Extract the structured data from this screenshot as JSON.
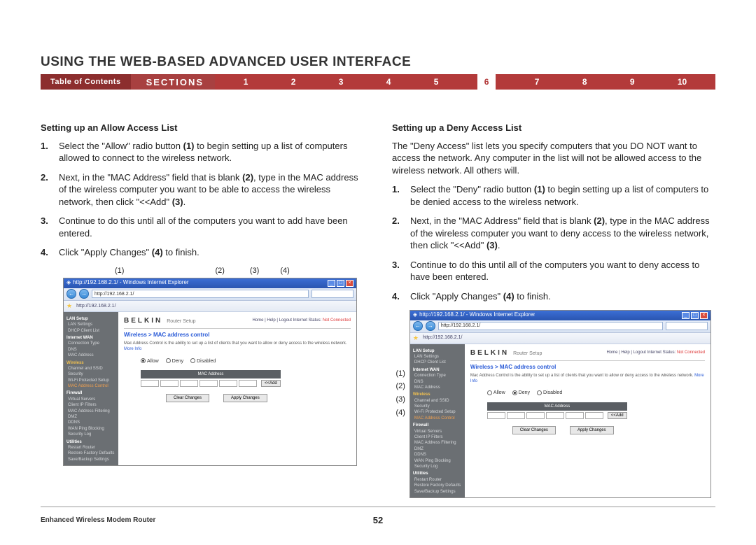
{
  "page_title": "USING THE WEB-BASED ADVANCED USER INTERFACE",
  "nav": {
    "toc": "Table of Contents",
    "sections": "SECTIONS",
    "items": [
      "1",
      "2",
      "3",
      "4",
      "5",
      "6",
      "7",
      "8",
      "9",
      "10"
    ],
    "current": "6"
  },
  "left": {
    "heading": "Setting up an Allow Access List",
    "steps": {
      "s1": {
        "num": "1.",
        "a": "Select the \"Allow\" radio button ",
        "b": "(1)",
        "c": " to begin setting up a list of computers allowed to connect to the wireless network."
      },
      "s2": {
        "num": "2.",
        "a": "Next, in the \"MAC Address\" field that is blank ",
        "b": "(2)",
        "c": ", type in the MAC address of the wireless computer you want to be able to access the wireless network, then click \"<<Add\" ",
        "d": "(3)",
        "e": "."
      },
      "s3": {
        "num": "3.",
        "a": "Continue to do this until all of the computers you want to add have been entered."
      },
      "s4": {
        "num": "4.",
        "a": "Click \"Apply Changes\" ",
        "b": "(4)",
        "c": " to finish."
      }
    },
    "callouts": [
      "(1)",
      "(2)",
      "(3)",
      "(4)"
    ]
  },
  "right": {
    "heading": "Setting up a Deny Access List",
    "intro": "The \"Deny Access\" list lets you specify computers that you DO NOT want to access the network. Any computer in the list will not be allowed access to the wireless network. All others will.",
    "steps": {
      "s1": {
        "num": "1.",
        "a": "Select the \"Deny\" radio button ",
        "b": "(1)",
        "c": " to begin setting up a list of computers to be denied access to the wireless network."
      },
      "s2": {
        "num": "2.",
        "a": "Next, in the \"MAC Address\" field that is blank ",
        "b": "(2)",
        "c": ", type in the MAC address of the wireless computer you want to deny access to the wireless network, then click \"<<Add\" ",
        "d": "(3)",
        "e": "."
      },
      "s3": {
        "num": "3.",
        "a": "Continue to do this until all of the computers you want to deny access to have been entered."
      },
      "s4": {
        "num": "4.",
        "a": "Click \"Apply Changes\" ",
        "b": "(4)",
        "c": " to finish."
      }
    },
    "callouts": [
      "(1)",
      "(2)",
      "(3)",
      "(4)"
    ]
  },
  "browser": {
    "title": "http://192.168.2.1/ - Windows Internet Explorer",
    "url": "http://192.168.2.1/",
    "brand": "BELKIN",
    "brand_sub": "Router Setup",
    "status_links": "Home | Help | Logout   Internet Status:",
    "status_value": "Not Connected",
    "section_head": "Wireless > MAC address control",
    "section_desc": "Mac Address Control is the ability to set up a list of clients that you want to allow or deny access to the wireless network.",
    "more": "More Info",
    "radios": {
      "allow": "Allow",
      "deny": "Deny",
      "disabled": "Disabled"
    },
    "mac_header": "MAC Address",
    "add_btn": "<<Add",
    "clear_btn": "Clear Changes",
    "apply_btn": "Apply Changes",
    "sidebar": {
      "lan_setup": "LAN Setup",
      "lan_settings": "LAN Settings",
      "dhcp": "DHCP Client List",
      "wan": "Internet WAN",
      "conn": "Connection Type",
      "dns": "DNS",
      "mac": "MAC Address",
      "wireless": "Wireless",
      "channel": "Channel and SSID",
      "security": "Security",
      "wps": "Wi-Fi Protected Setup",
      "mac_ctrl": "MAC Address Control",
      "firewall": "Firewall",
      "virtual": "Virtual Servers",
      "ipfilter": "Client IP Filters",
      "macfilter": "MAC Address Filtering",
      "dmz": "DMZ",
      "ddns": "DDNS",
      "wanping": "WAN Ping Blocking",
      "seclog": "Security Log",
      "utilities": "Utilities",
      "restart": "Restart Router",
      "restore": "Restore Factory Defaults",
      "save": "Save/Backup Settings"
    }
  },
  "footer": {
    "product": "Enhanced Wireless Modem Router",
    "page": "52"
  }
}
